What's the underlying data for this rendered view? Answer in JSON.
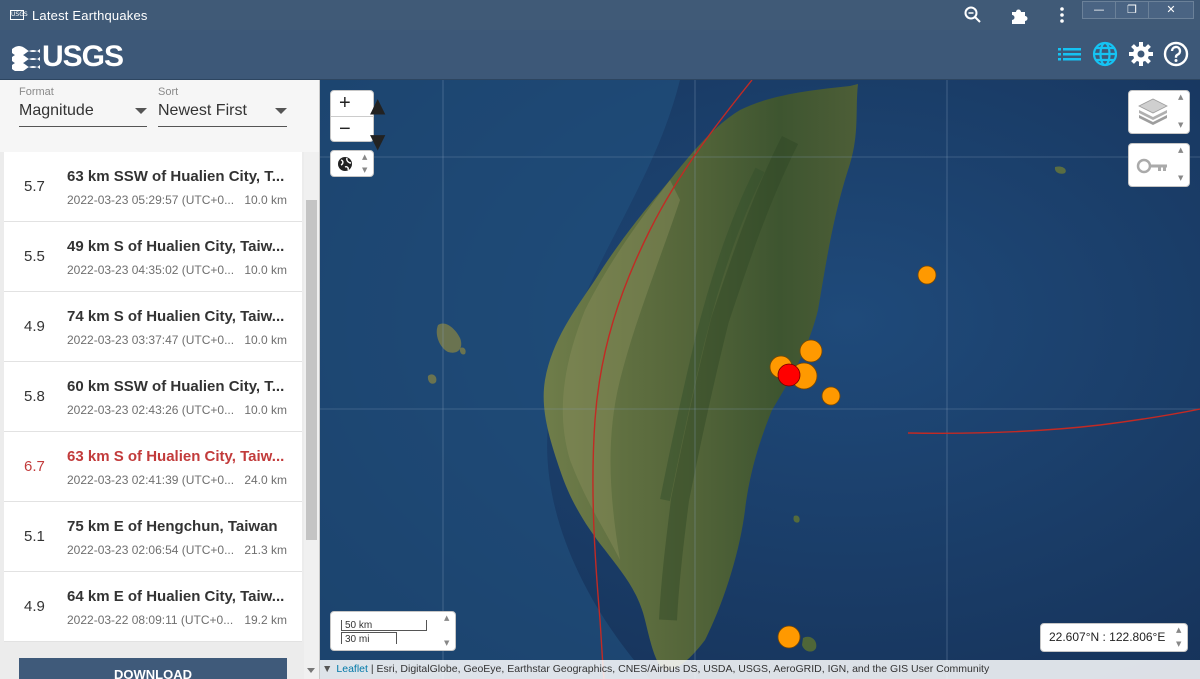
{
  "window": {
    "app_icon_text": "USGS",
    "title": "Latest Earthquakes",
    "icons": [
      "zoom-icon",
      "extensions-icon",
      "more-vert-icon"
    ],
    "buttons": {
      "minimize": "—",
      "restore": "❐",
      "close": "✕"
    }
  },
  "header": {
    "logo_text": "USGS",
    "icons": [
      "list-icon",
      "globe-icon",
      "settings-icon",
      "help-icon"
    ],
    "accent_color": "#15c3f3"
  },
  "controls": {
    "format_label": "Format",
    "format_value": "Magnitude",
    "sort_label": "Sort",
    "sort_value": "Newest First"
  },
  "earthquakes": [
    {
      "mag": "5.7",
      "place": "63 km SSW of Hualien City, T...",
      "time": "2022-03-23 05:29:57 (UTC+0...",
      "depth": "10.0 km"
    },
    {
      "mag": "5.5",
      "place": "49 km S of Hualien City, Taiw...",
      "time": "2022-03-23 04:35:02 (UTC+0...",
      "depth": "10.0 km"
    },
    {
      "mag": "4.9",
      "place": "74 km S of Hualien City, Taiw...",
      "time": "2022-03-23 03:37:47 (UTC+0...",
      "depth": "10.0 km"
    },
    {
      "mag": "5.8",
      "place": "60 km SSW of Hualien City, T...",
      "time": "2022-03-23 02:43:26 (UTC+0...",
      "depth": "10.0 km"
    },
    {
      "mag": "6.7",
      "place": "63 km S of Hualien City, Taiw...",
      "time": "2022-03-23 02:41:39 (UTC+0...",
      "depth": "24.0 km",
      "selected": true
    },
    {
      "mag": "5.1",
      "place": "75 km E of Hengchun, Taiwan",
      "time": "2022-03-23 02:06:54 (UTC+0...",
      "depth": "21.3 km"
    },
    {
      "mag": "4.9",
      "place": "64 km E of Hualien City, Taiw...",
      "time": "2022-03-22 08:09:11 (UTC+0...",
      "depth": "19.2 km"
    }
  ],
  "download_label": "DOWNLOAD",
  "map": {
    "zoom_in": "+",
    "zoom_out": "−",
    "scale_km": "50 km",
    "scale_mi": "30 mi",
    "coordinates": "22.607°N : 122.806°E",
    "attribution_link": "Leaflet",
    "attribution_text": " | Esri, DigitalGlobe, GeoEye, Earthstar Geographics, CNES/Airbus DS, USDA, USGS, AeroGRID, IGN, and the GIS User Community",
    "marker_colors": {
      "recent": "#ff9900",
      "selected": "#ff0000"
    }
  }
}
